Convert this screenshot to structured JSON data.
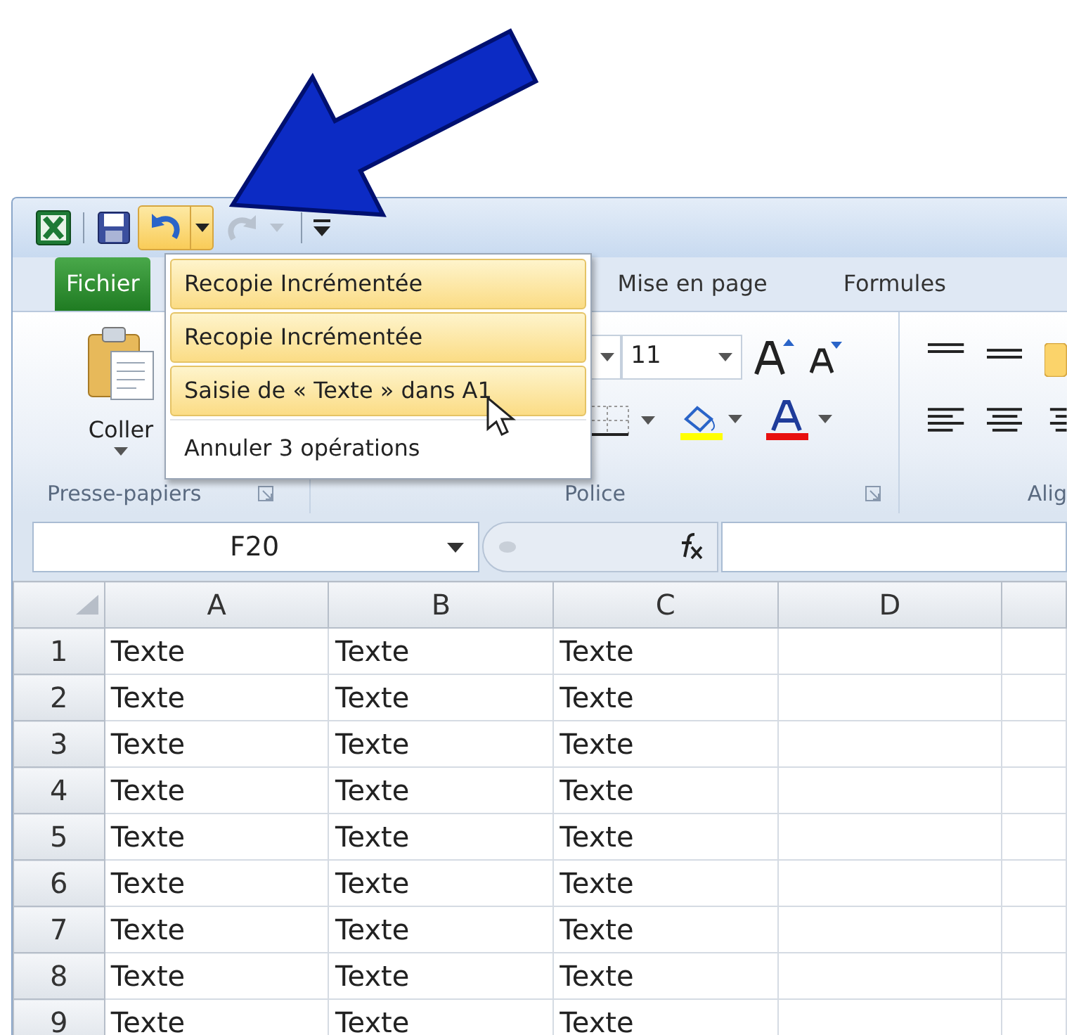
{
  "quick_access": {
    "undo_menu_open": true,
    "redo_enabled": false
  },
  "undo_menu": {
    "items": [
      {
        "label": "Recopie Incrémentée",
        "highlighted": true
      },
      {
        "label": "Recopie Incrémentée",
        "highlighted": true
      },
      {
        "label": "Saisie de « Texte » dans A1",
        "highlighted": true
      }
    ],
    "footer": "Annuler 3 opérations"
  },
  "tabs": [
    {
      "label": "Fichier",
      "kind": "file"
    },
    {
      "label": "Mise en page",
      "kind": "normal"
    },
    {
      "label": "Formules",
      "kind": "normal"
    }
  ],
  "ribbon": {
    "clipboard": {
      "paste_label": "Coller",
      "group_label": "Presse-papiers"
    },
    "font": {
      "size": "11",
      "group_label": "Police"
    },
    "alignment": {
      "group_label": "Alig"
    }
  },
  "formula_bar": {
    "name_box": "F20"
  },
  "grid": {
    "columns": [
      "A",
      "B",
      "C",
      "D"
    ],
    "rows": [
      {
        "header": "1",
        "cells": [
          "Texte",
          "Texte",
          "Texte"
        ]
      },
      {
        "header": "2",
        "cells": [
          "Texte",
          "Texte",
          "Texte"
        ]
      },
      {
        "header": "3",
        "cells": [
          "Texte",
          "Texte",
          "Texte"
        ]
      },
      {
        "header": "4",
        "cells": [
          "Texte",
          "Texte",
          "Texte"
        ]
      },
      {
        "header": "5",
        "cells": [
          "Texte",
          "Texte",
          "Texte"
        ]
      },
      {
        "header": "6",
        "cells": [
          "Texte",
          "Texte",
          "Texte"
        ]
      },
      {
        "header": "7",
        "cells": [
          "Texte",
          "Texte",
          "Texte"
        ]
      },
      {
        "header": "8",
        "cells": [
          "Texte",
          "Texte",
          "Texte"
        ]
      },
      {
        "header": "9",
        "cells": [
          "Texte",
          "Texte",
          "Texte"
        ]
      }
    ]
  }
}
